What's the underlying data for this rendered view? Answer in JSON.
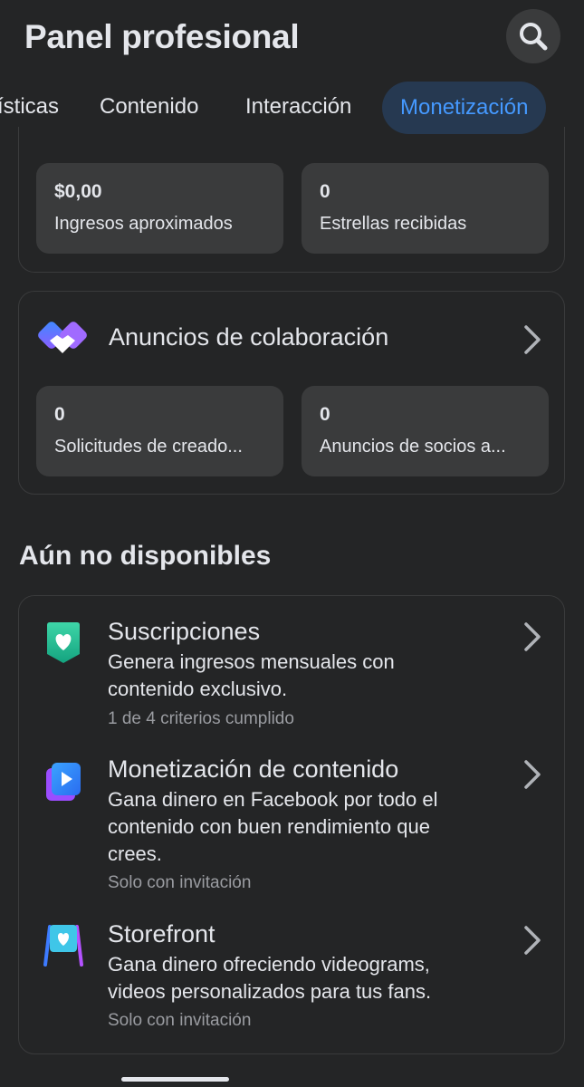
{
  "header": {
    "title": "Panel profesional"
  },
  "tabs": [
    {
      "label": "ísticas"
    },
    {
      "label": "Contenido"
    },
    {
      "label": "Interacción"
    },
    {
      "label": "Monetización",
      "active": true
    }
  ],
  "earnings": {
    "income_value": "$0,00",
    "income_label": "Ingresos aproximados",
    "stars_value": "0",
    "stars_label": "Estrellas recibidas"
  },
  "collab": {
    "title": "Anuncios de colaboración",
    "requests_value": "0",
    "requests_label": "Solicitudes de creado...",
    "partner_value": "0",
    "partner_label": "Anuncios de socios a..."
  },
  "unavailable": {
    "section_title": "Aún no disponibles",
    "items": [
      {
        "title": "Suscripciones",
        "desc_lines": [
          "Genera ingresos mensuales con",
          "contenido exclusivo."
        ],
        "meta": "1 de 4 criterios cumplido",
        "icon": "heart-shield-icon"
      },
      {
        "title": "Monetización de contenido",
        "desc_lines": [
          "Gana dinero en Facebook por todo el",
          "contenido con buen rendimiento que",
          "crees."
        ],
        "meta": "Solo con invitación",
        "icon": "play-video-icon"
      },
      {
        "title": "Storefront",
        "desc_lines": [
          "Gana dinero ofreciendo videograms,",
          "videos personalizados para tus fans."
        ],
        "meta": "Solo con invitación",
        "icon": "storefront-icon"
      }
    ]
  },
  "colors": {
    "background": "#242526",
    "surface": "#3a3b3c",
    "accent": "#4599ff",
    "accent_bg": "#263951",
    "text": "#e4e6eb",
    "muted": "#9a9ca1"
  }
}
